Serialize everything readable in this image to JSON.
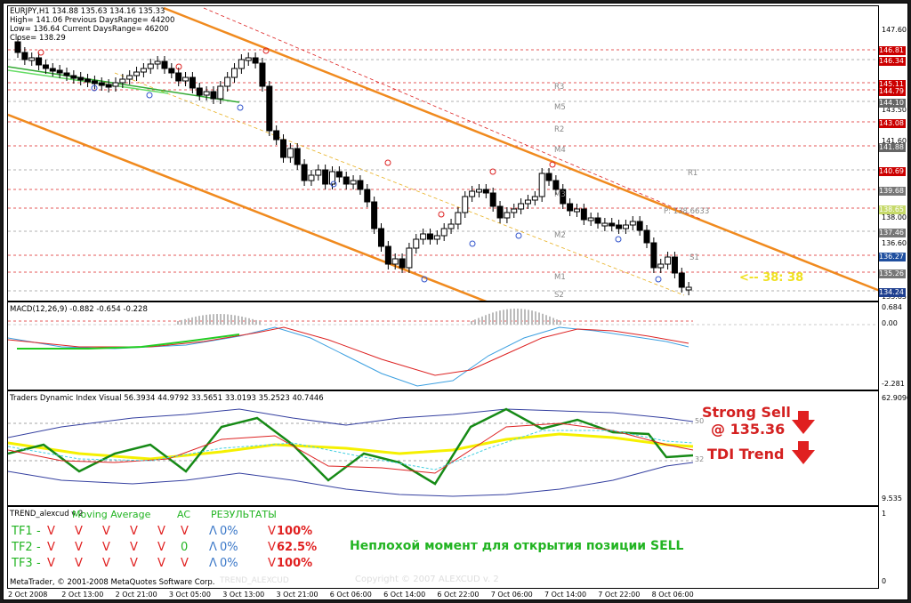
{
  "chart_info": {
    "lines": [
      "EURJPY,H1  134.88 135.63 134.16 135.33",
      "High= 141.06 Previous DaysRange= 44200",
      "Low= 136.64 Current DaysRange= 46200",
      "Close= 138.29"
    ]
  },
  "price_axis": [
    "147.60",
    "141.60",
    "143.50",
    "138.00",
    "136.60",
    "133.85"
  ],
  "price_tags": [
    {
      "text": "146.81",
      "bg": "#cc0000",
      "fg": "#ffffff"
    },
    {
      "text": "146.34",
      "bg": "#cc0000",
      "fg": "#ffffff"
    },
    {
      "text": "145.11",
      "bg": "#cc0000",
      "fg": "#ffffff"
    },
    {
      "text": "144.79",
      "bg": "#cc0000",
      "fg": "#ffffff"
    },
    {
      "text": "144.10",
      "bg": "#666666",
      "fg": "#ffffff"
    },
    {
      "text": "143.08",
      "bg": "#cc0000",
      "fg": "#ffffff"
    },
    {
      "text": "141.88",
      "bg": "#666666",
      "fg": "#ffffff"
    },
    {
      "text": "140.69",
      "bg": "#cc0000",
      "fg": "#ffffff"
    },
    {
      "text": "139.68",
      "bg": "#777777",
      "fg": "#ffffff"
    },
    {
      "text": "138.65",
      "bg": "#c6d96a",
      "fg": "#ffffff"
    },
    {
      "text": "137.46",
      "bg": "#777777",
      "fg": "#ffffff"
    },
    {
      "text": "136.27",
      "bg": "#1f4f9f",
      "fg": "#ffffff"
    },
    {
      "text": "135.26",
      "bg": "#777777",
      "fg": "#ffffff"
    },
    {
      "text": "134.24",
      "bg": "#1f3f8f",
      "fg": "#ffffff"
    }
  ],
  "pivot_labels": [
    "R3",
    "M5",
    "R2",
    "M4",
    "R1",
    "M3",
    "P",
    "M2",
    "M1",
    "S2",
    "S1"
  ],
  "pivot_value_label": "P: 138.6633",
  "countdown": "<-- 38: 38",
  "macd": {
    "title": "MACD(12,26,9) -0.882 -0.654 -0.228",
    "axis": [
      "0.684",
      "0.00",
      "-2.281"
    ]
  },
  "tdi": {
    "title": "Traders Dynamic Index Visual 56.3934 44.9792 33.5651 33.0193 35.2523 40.7446",
    "axis": [
      "62.9096",
      "9.535"
    ],
    "level_50": "50",
    "level_32": "32",
    "signal_line1": "Strong Sell",
    "signal_line2": "@ 135.36",
    "trend_label": "TDI Trend",
    "colors": {
      "signal": "#d42020",
      "arrow": "#e02020"
    }
  },
  "trend_panel": {
    "title": "TREND_alexcud v 2",
    "axis": [
      "1",
      "0"
    ],
    "header_ma": "Moving Average",
    "header_ac": "AC",
    "header_res": "РЕЗУЛЬТАТЫ",
    "rows": [
      {
        "tf": "TF1",
        "ma": [
          "V",
          "V",
          "V",
          "V",
          "V"
        ],
        "ac": "V",
        "pct": "0%",
        "res": "100%"
      },
      {
        "tf": "TF2",
        "ma": [
          "V",
          "V",
          "V",
          "V",
          "V"
        ],
        "ac": "0",
        "pct": "0%",
        "res": "62.5%"
      },
      {
        "tf": "TF3",
        "ma": [
          "V",
          "V",
          "V",
          "V",
          "V"
        ],
        "ac": "V",
        "pct": "0%",
        "res": "100%"
      }
    ],
    "message": "Неплохой момент для открытия позиции SELL",
    "copyright_watermark": "Copyright © 2007 ALEXCUD v. 2",
    "watermark2": "TREND_ALEXCUD",
    "colors": {
      "green": "#22b422",
      "red": "#e02020",
      "blue": "#3b78c8"
    }
  },
  "footer_copyright": "MetaTrader, © 2001-2008 MetaQuotes Software Corp.",
  "time_axis": [
    "2 Oct 2008",
    "2 Oct 13:00",
    "2 Oct 21:00",
    "3 Oct 05:00",
    "3 Oct 13:00",
    "3 Oct 21:00",
    "6 Oct 06:00",
    "6 Oct 14:00",
    "6 Oct 22:00",
    "7 Oct 06:00",
    "7 Oct 14:00",
    "7 Oct 22:00",
    "8 Oct 06:00"
  ]
}
